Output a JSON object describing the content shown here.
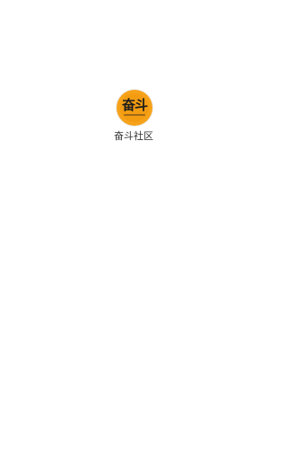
{
  "splash": {
    "logo_text": "奋斗",
    "app_name": "奋斗社区"
  },
  "colors": {
    "background": "#ffffff",
    "logo_orange": "#f39c12",
    "logo_text": "#1c1c1c",
    "app_name_text": "#333333"
  }
}
